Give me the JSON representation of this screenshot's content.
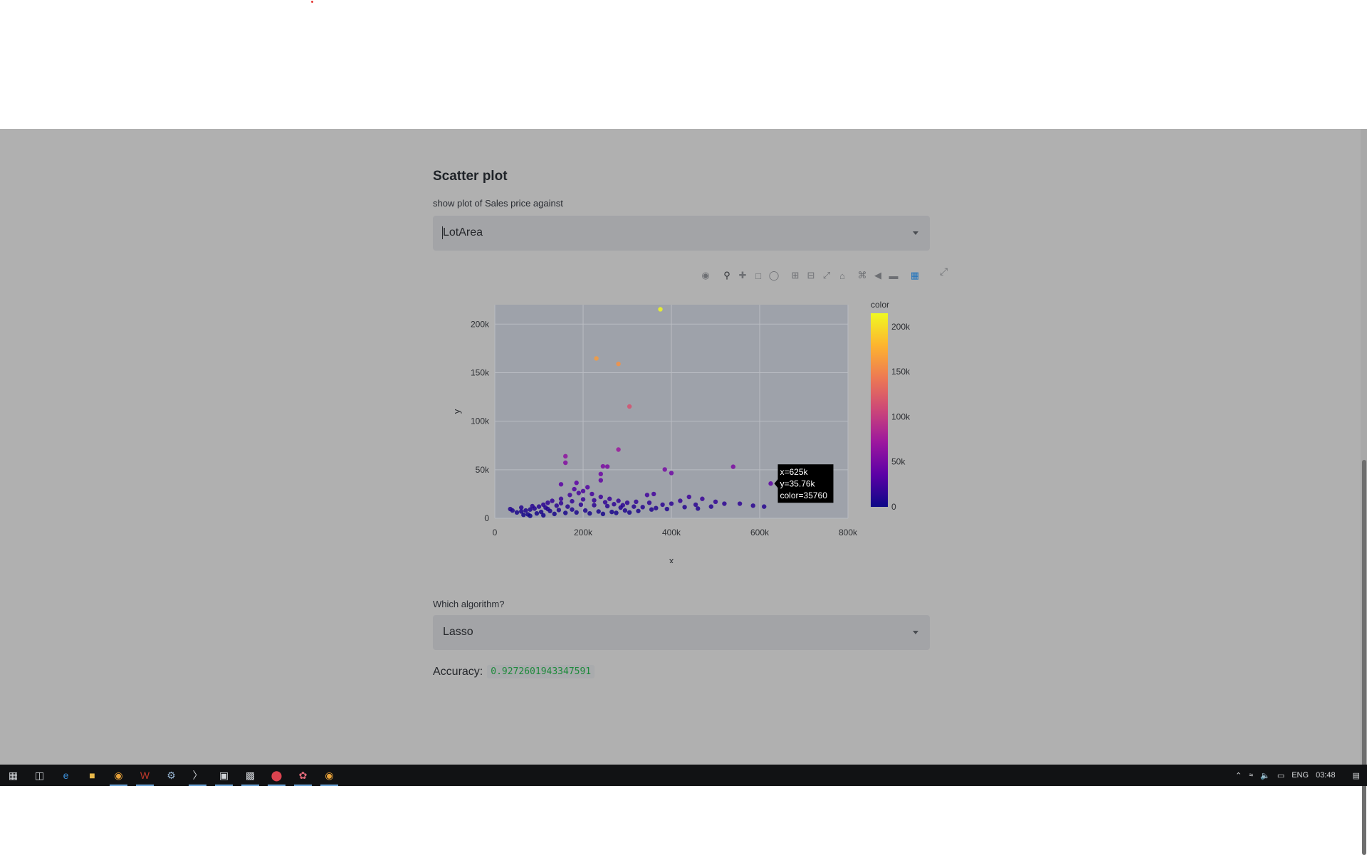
{
  "app": {
    "title": "Scatter plot",
    "x_selector_label": "show plot of Sales price against",
    "x_selector_value": "LotArea",
    "algo_label": "Which algorithm?",
    "algo_value": "Lasso",
    "accuracy_label": "Accuracy:",
    "accuracy_value": "0.9272601943347591"
  },
  "modebar": {
    "icons": [
      "camera-icon",
      "zoom-icon",
      "pan-icon",
      "box-select-icon",
      "lasso-select-icon",
      "zoom-in-icon",
      "zoom-out-icon",
      "autoscale-icon",
      "reset-axes-icon",
      "spike-lines-icon",
      "hover-closest-icon",
      "hover-compare-icon",
      "plotly-logo-icon"
    ],
    "expand_icon": "fullscreen-icon"
  },
  "tooltip": {
    "line1": "x=625k",
    "line2": "y=35.76k",
    "line3": "color=35760"
  },
  "chart_data": {
    "type": "scatter",
    "xlabel": "x",
    "ylabel": "y",
    "xlim": [
      0,
      800000
    ],
    "ylim": [
      0,
      220000
    ],
    "x_ticks": [
      "0",
      "200k",
      "400k",
      "600k",
      "800k"
    ],
    "y_ticks": [
      "0",
      "50k",
      "100k",
      "150k",
      "200k"
    ],
    "colorbar_title": "color",
    "colorbar_ticks": [
      "0",
      "50k",
      "100k",
      "150k",
      "200k"
    ],
    "colorscale": [
      "#0d0887",
      "#5c01a6",
      "#9c179e",
      "#cc4778",
      "#ed7953",
      "#fdb42f",
      "#f0f921"
    ],
    "grid": true,
    "points": [
      [
        375000,
        215245
      ],
      [
        230000,
        164660
      ],
      [
        280000,
        159000
      ],
      [
        305000,
        115149
      ],
      [
        280000,
        70761
      ],
      [
        160000,
        63887
      ],
      [
        160000,
        57200
      ],
      [
        245000,
        53504
      ],
      [
        255000,
        53227
      ],
      [
        540000,
        53107
      ],
      [
        385000,
        50271
      ],
      [
        400000,
        46589
      ],
      [
        240000,
        45600
      ],
      [
        240000,
        39104
      ],
      [
        625000,
        35760
      ],
      [
        185000,
        36500
      ],
      [
        150000,
        35000
      ],
      [
        360000,
        25000
      ],
      [
        345000,
        24000
      ],
      [
        440000,
        22000
      ],
      [
        470000,
        20000
      ],
      [
        500000,
        17000
      ],
      [
        520000,
        15000
      ],
      [
        555000,
        15000
      ],
      [
        585000,
        13000
      ],
      [
        610000,
        12000
      ],
      [
        455000,
        14000
      ],
      [
        420000,
        18000
      ],
      [
        400000,
        15000
      ],
      [
        380000,
        14000
      ],
      [
        350000,
        16000
      ],
      [
        320000,
        17000
      ],
      [
        300000,
        16000
      ],
      [
        280000,
        18000
      ],
      [
        260000,
        20000
      ],
      [
        240000,
        22000
      ],
      [
        220000,
        25000
      ],
      [
        200000,
        28000
      ],
      [
        180000,
        30000
      ],
      [
        170000,
        24000
      ],
      [
        210000,
        32000
      ],
      [
        190000,
        26000
      ],
      [
        150000,
        20000
      ],
      [
        130000,
        18000
      ],
      [
        120000,
        16000
      ],
      [
        110000,
        14000
      ],
      [
        100000,
        12000
      ],
      [
        90000,
        10000
      ],
      [
        80000,
        9000
      ],
      [
        70000,
        8000
      ],
      [
        60000,
        7000
      ],
      [
        50000,
        6000
      ],
      [
        40000,
        8000
      ],
      [
        35000,
        9500
      ],
      [
        60000,
        11000
      ],
      [
        85000,
        12500
      ],
      [
        115000,
        11000
      ],
      [
        140000,
        13000
      ],
      [
        165000,
        12000
      ],
      [
        195000,
        14000
      ],
      [
        225000,
        13500
      ],
      [
        255000,
        12500
      ],
      [
        285000,
        11000
      ],
      [
        315000,
        12000
      ],
      [
        335000,
        11500
      ],
      [
        365000,
        10500
      ],
      [
        390000,
        9500
      ],
      [
        430000,
        11500
      ],
      [
        460000,
        10000
      ],
      [
        490000,
        12000
      ],
      [
        75000,
        4000
      ],
      [
        95000,
        5000
      ],
      [
        105000,
        6500
      ],
      [
        125000,
        7500
      ],
      [
        145000,
        8500
      ],
      [
        175000,
        9000
      ],
      [
        205000,
        8000
      ],
      [
        235000,
        7000
      ],
      [
        265000,
        6500
      ],
      [
        295000,
        8000
      ],
      [
        325000,
        7500
      ],
      [
        355000,
        9000
      ],
      [
        65000,
        3500
      ],
      [
        80000,
        2500
      ],
      [
        110000,
        3000
      ],
      [
        135000,
        4500
      ],
      [
        160000,
        5500
      ],
      [
        185000,
        6000
      ],
      [
        215000,
        5000
      ],
      [
        245000,
        4500
      ],
      [
        275000,
        5500
      ],
      [
        305000,
        6000
      ],
      [
        150000,
        15500
      ],
      [
        175000,
        17500
      ],
      [
        200000,
        19500
      ],
      [
        225000,
        18500
      ],
      [
        250000,
        16500
      ],
      [
        270000,
        14500
      ],
      [
        290000,
        13500
      ],
      [
        120000,
        9500
      ]
    ]
  },
  "taskbar": {
    "icons": [
      "windows-start-icon",
      "task-view-icon",
      "edge-icon",
      "file-explorer-icon",
      "chrome-icon",
      "app-icon",
      "steam-icon",
      "terminal-icon",
      "photos-icon",
      "cmd-icon",
      "app-red-icon",
      "settings-icon",
      "chrome-canary-icon"
    ],
    "lang": "ENG",
    "time": "03:48"
  }
}
